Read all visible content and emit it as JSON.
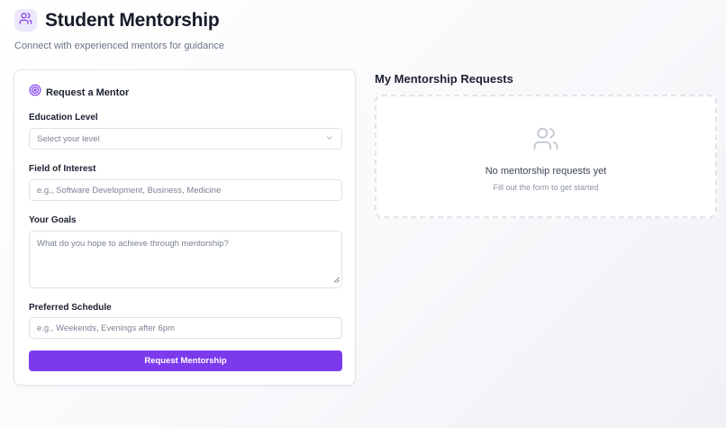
{
  "header": {
    "title": "Student Mentorship",
    "subtitle": "Connect with experienced mentors for guidance",
    "logo_icon": "users-icon"
  },
  "form": {
    "title": "Request a Mentor",
    "title_icon": "target-icon",
    "education_label": "Education Level",
    "education_placeholder": "Select your level",
    "field_label": "Field of Interest",
    "field_placeholder": "e.g., Software Development, Business, Medicine",
    "goals_label": "Your Goals",
    "goals_placeholder": "What do you hope to achieve through mentorship?",
    "schedule_label": "Preferred Schedule",
    "schedule_placeholder": "e.g., Weekends, Evenings after 6pm",
    "submit_label": "Request Mentorship"
  },
  "requests": {
    "title": "My Mentorship Requests",
    "empty_title": "No mentorship requests yet",
    "empty_subtitle": "Fill out the form to get started",
    "empty_icon": "users-icon"
  },
  "colors": {
    "accent": "#7c3aed",
    "logo_bg": "#ede7fb",
    "text_primary": "#1c2030",
    "text_muted": "#6b7586"
  }
}
